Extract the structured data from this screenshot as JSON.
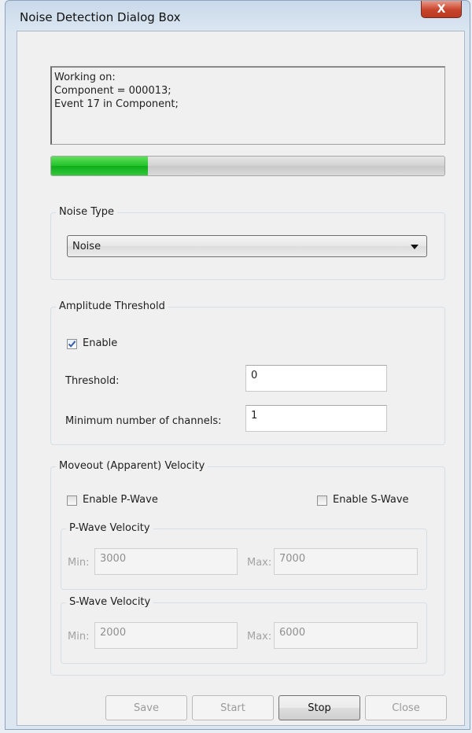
{
  "window": {
    "title": "Noise Detection Dialog Box",
    "close_glyph": "X",
    "accent_close_color": "#c8432b"
  },
  "status": {
    "lines": [
      "Working on:",
      "Component = 000013;",
      "Event 17 in Component;"
    ]
  },
  "progress": {
    "fraction": 0.245,
    "color": "#22c22a"
  },
  "noise_type": {
    "legend": "Noise Type",
    "selected": "Noise"
  },
  "amplitude": {
    "legend": "Amplitude Threshold",
    "enable_label": "Enable",
    "enable_checked": true,
    "threshold_label": "Threshold:",
    "threshold_value": "0",
    "min_channels_label": "Minimum number of channels:",
    "min_channels_value": "1"
  },
  "moveout": {
    "legend": "Moveout (Apparent) Velocity",
    "enable_p_label": "Enable P-Wave",
    "enable_p_checked": false,
    "enable_s_label": "Enable S-Wave",
    "enable_s_checked": false,
    "p_wave": {
      "legend": "P-Wave Velocity",
      "min_label": "Min:",
      "min_value": "3000",
      "max_label": "Max:",
      "max_value": "7000"
    },
    "s_wave": {
      "legend": "S-Wave Velocity",
      "min_label": "Min:",
      "min_value": "2000",
      "max_label": "Max:",
      "max_value": "6000"
    }
  },
  "buttons": {
    "save": "Save",
    "start": "Start",
    "stop": "Stop",
    "close": "Close"
  },
  "icons": {
    "checkmark": "check-icon",
    "dropdown": "chevron-down-icon"
  }
}
